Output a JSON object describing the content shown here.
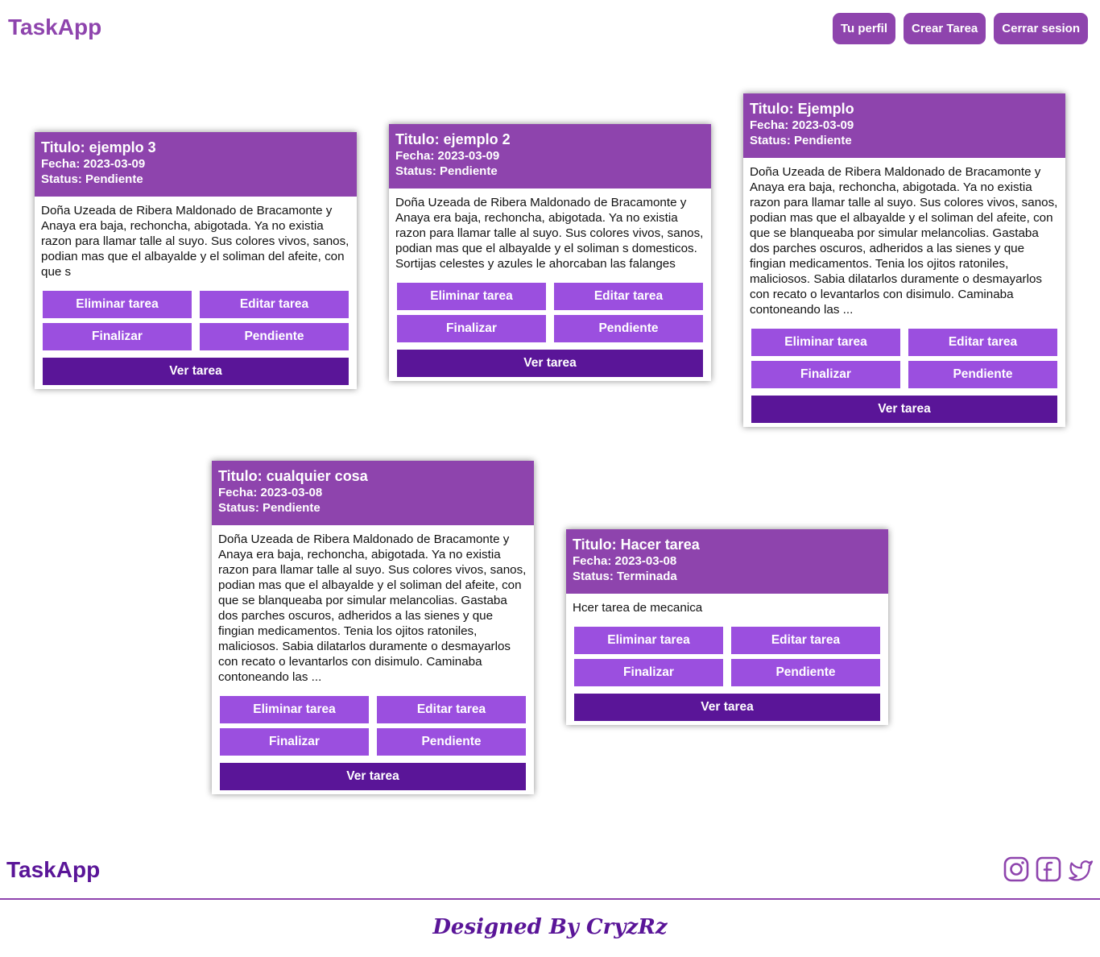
{
  "app": {
    "name": "TaskApp"
  },
  "nav": {
    "profile": "Tu perfil",
    "create": "Crear Tarea",
    "logout": "Cerrar sesion"
  },
  "actions": {
    "delete": "Eliminar tarea",
    "edit": "Editar tarea",
    "finish": "Finalizar",
    "pending": "Pendiente",
    "view": "Ver tarea"
  },
  "tasks": [
    {
      "title": "Titulo: ejemplo 3",
      "date": "Fecha: 2023-03-09",
      "status": "Status: Pendiente",
      "description": "Doña Uzeada de Ribera Maldonado de Bracamonte y Anaya era baja, rechoncha, abigotada. Ya no existia razon para llamar talle al suyo. Sus colores vivos, sanos, podian mas que el albayalde y el soliman del afeite, con que s"
    },
    {
      "title": "Titulo: ejemplo 2",
      "date": "Fecha: 2023-03-09",
      "status": "Status: Pendiente",
      "description": "Doña Uzeada de Ribera Maldonado de Bracamonte y Anaya era baja, rechoncha, abigotada. Ya no existia razon para llamar talle al suyo. Sus colores vivos, sanos, podian mas que el albayalde y el soliman s domesticos. Sortijas celestes y azules le ahorcaban las falanges"
    },
    {
      "title": "Titulo: Ejemplo",
      "date": "Fecha: 2023-03-09",
      "status": "Status: Pendiente",
      "description": "Doña Uzeada de Ribera Maldonado de Bracamonte y Anaya era baja, rechoncha, abigotada. Ya no existia razon para llamar talle al suyo. Sus colores vivos, sanos, podian mas que el albayalde y el soliman del afeite, con que se blanqueaba por simular melancolias. Gastaba dos parches oscuros, adheridos a las sienes y que fingian medicamentos. Tenia los ojitos ratoniles, maliciosos. Sabia dilatarlos duramente o desmayarlos con recato o levantarlos con disimulo. Caminaba contoneando las ..."
    },
    {
      "title": "Titulo: cualquier cosa",
      "date": "Fecha: 2023-03-08",
      "status": "Status: Pendiente",
      "description": "Doña Uzeada de Ribera Maldonado de Bracamonte y Anaya era baja, rechoncha, abigotada. Ya no existia razon para llamar talle al suyo. Sus colores vivos, sanos, podian mas que el albayalde y el soliman del afeite, con que se blanqueaba por simular melancolias. Gastaba dos parches oscuros, adheridos a las sienes y que fingian medicamentos. Tenia los ojitos ratoniles, maliciosos. Sabia dilatarlos duramente o desmayarlos con recato o levantarlos con disimulo. Caminaba contoneando las ..."
    },
    {
      "title": "Titulo: Hacer tarea",
      "date": "Fecha: 2023-03-08",
      "status": "Status: Terminada",
      "description": "Hcer tarea de mecanica"
    }
  ],
  "footer": {
    "brand": "TaskApp",
    "credit": "Designed By CryzRz",
    "icons": [
      "instagram-icon",
      "facebook-icon",
      "twitter-icon"
    ]
  },
  "colors": {
    "primary": "#8e44ad",
    "button": "#9b4fdf",
    "dark": "#5a1598"
  }
}
